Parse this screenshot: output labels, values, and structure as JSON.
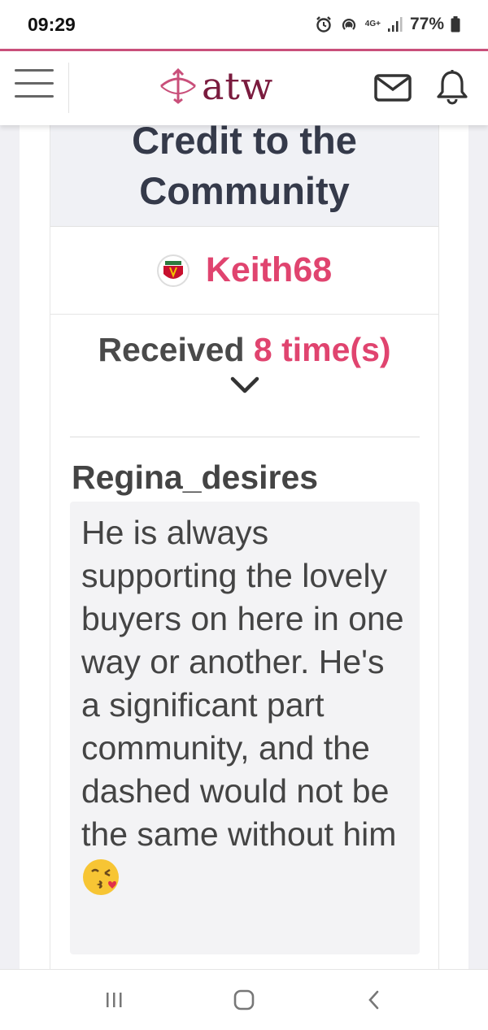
{
  "status_bar": {
    "time": "09:29",
    "network": "4G+",
    "battery": "77%"
  },
  "app_bar": {
    "logo_text": "atw"
  },
  "card": {
    "title": "Credit to the Community",
    "username": "Keith68",
    "received_prefix": "Received",
    "received_count": "8 time(s)",
    "giver": "Regina_desires",
    "comment": "He is always supporting the lovely buyers on here in one way or another. He's a significant part community, and the dashed would not be the same without him",
    "emoji": "😘"
  },
  "colors": {
    "accent": "#e0446f",
    "brand": "#7a1b3e",
    "top_border": "#c94f7a"
  }
}
